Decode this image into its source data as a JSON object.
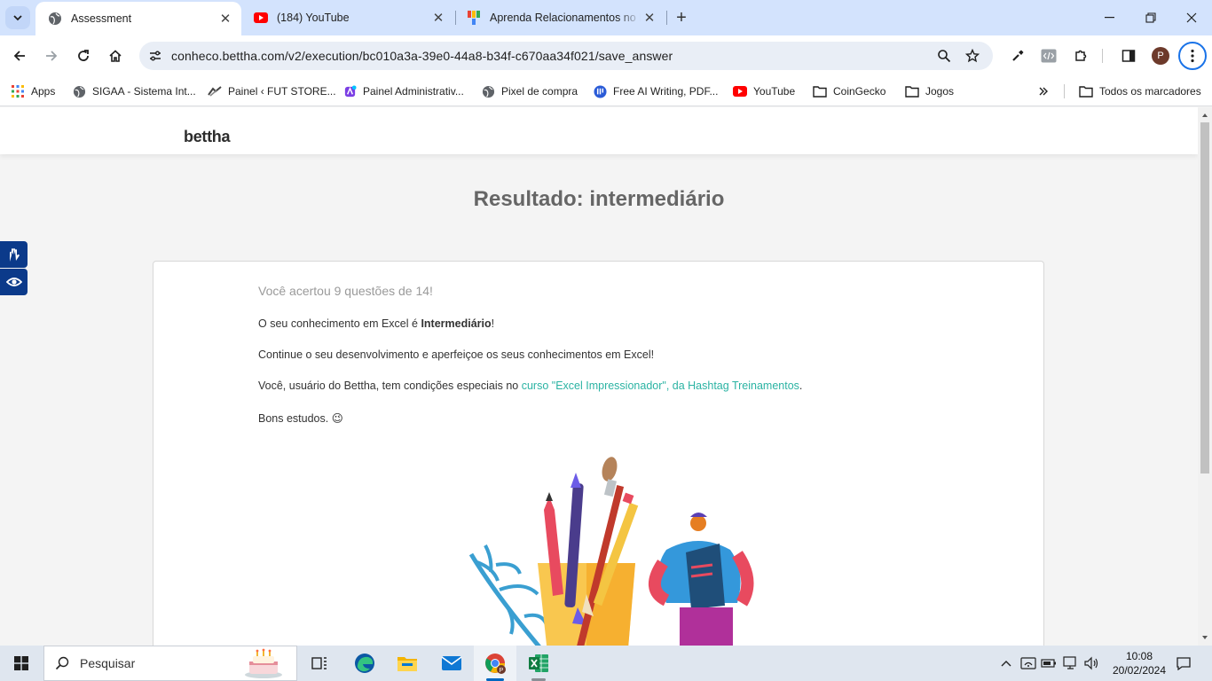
{
  "browser": {
    "tabs": [
      {
        "title": "Assessment",
        "active": true
      },
      {
        "title": "(184) YouTube",
        "active": false
      },
      {
        "title": "Aprenda Relacionamentos no P",
        "active": false
      }
    ],
    "url": "conheco.bettha.com/v2/execution/bc010a3a-39e0-44a8-b34f-c670aa34f021/save_answer",
    "profile_initial": "P",
    "bookmarks": [
      {
        "label": "Apps",
        "icon": "apps-grid-icon"
      },
      {
        "label": "SIGAA - Sistema Int...",
        "icon": "globe-icon"
      },
      {
        "label": "Painel ‹ FUT STORE...",
        "icon": "fut-store-icon"
      },
      {
        "label": "Painel Administrativ...",
        "icon": "admin-panel-icon"
      },
      {
        "label": "Pixel de compra",
        "icon": "globe-icon"
      },
      {
        "label": "Free AI Writing, PDF...",
        "icon": "ai-writing-icon"
      },
      {
        "label": "YouTube",
        "icon": "youtube-icon"
      },
      {
        "label": "CoinGecko",
        "icon": "folder-icon"
      },
      {
        "label": "Jogos",
        "icon": "folder-icon"
      }
    ],
    "all_bookmarks_label": "Todos os marcadores"
  },
  "site": {
    "logo": "bettha",
    "result_title": "Resultado: intermediário",
    "score_text": "Você acertou 9 questões de 14!",
    "p1_prefix": "O seu conhecimento em Excel é ",
    "p1_bold": "Intermediário",
    "p1_suffix": "!",
    "p2": "Continue o seu desenvolvimento e aperfeiçoe os seus conhecimentos em Excel!",
    "p3_prefix": "Você, usuário do Bettha, tem condições especiais no ",
    "p3_link": "curso \"Excel Impressionador\", da Hashtag Treinamentos",
    "p3_suffix": ".",
    "p4": "Bons estudos. 😉"
  },
  "taskbar": {
    "search_label": "Pesquisar",
    "time": "10:08",
    "date": "20/02/2024"
  },
  "colors": {
    "accent_link": "#2bb3a3",
    "chrome_tabstrip": "#d3e3fd",
    "a11y_widget": "#0b3a8a"
  }
}
